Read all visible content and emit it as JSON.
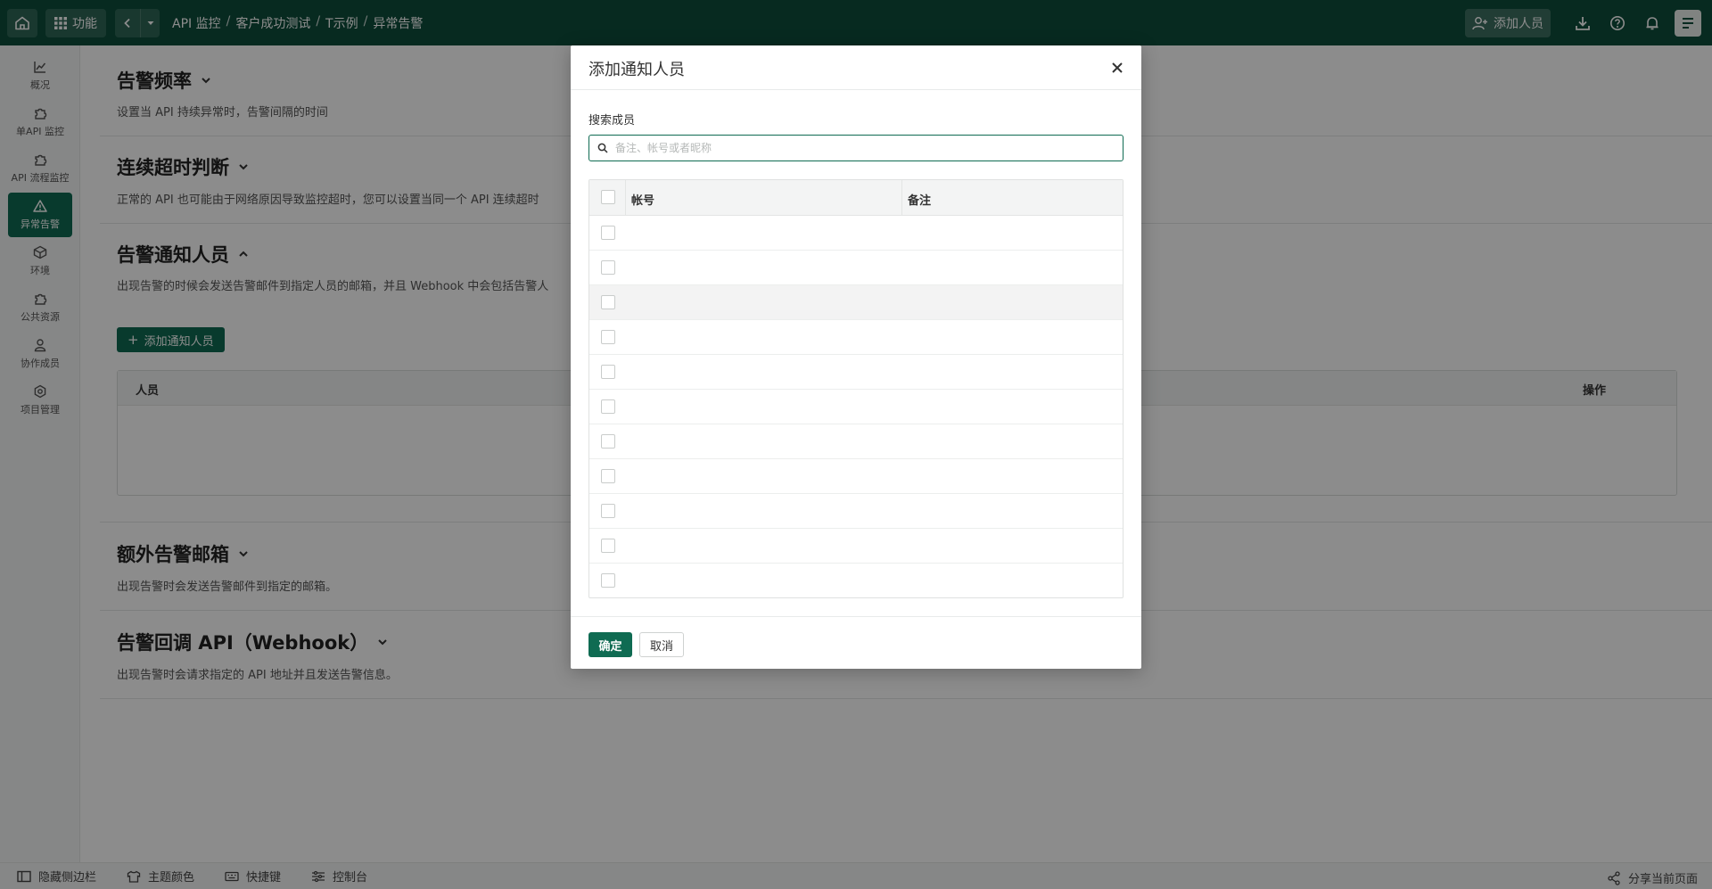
{
  "topbar": {
    "func_label": "功能",
    "breadcrumbs": [
      "API 监控",
      "客户成功测试",
      "T示例",
      "异常告警"
    ],
    "add_member_label": "添加人员"
  },
  "sidebar": {
    "items": [
      {
        "label": "概况",
        "icon": "chart-line-icon"
      },
      {
        "label": "单API 监控",
        "icon": "puzzle-icon"
      },
      {
        "label": "API 流程监控",
        "icon": "puzzle-icon"
      },
      {
        "label": "异常告警",
        "icon": "warning-icon",
        "active": true
      },
      {
        "label": "环境",
        "icon": "box-icon"
      },
      {
        "label": "公共资源",
        "icon": "puzzle-icon"
      },
      {
        "label": "协作成员",
        "icon": "user-icon"
      },
      {
        "label": "项目管理",
        "icon": "gear-icon"
      }
    ]
  },
  "main": {
    "sections": [
      {
        "title": "告警频率",
        "desc": "设置当 API 持续异常时，告警间隔的时间"
      },
      {
        "title": "连续超时判断",
        "desc": "正常的 API 也可能由于网络原因导致监控超时，您可以设置当同一个 API 连续超时"
      },
      {
        "title": "告警通知人员",
        "desc": "出现告警的时候会发送告警邮件到指定人员的邮箱，并且 Webhook 中会包括告警人"
      },
      {
        "title": "额外告警邮箱",
        "desc": "出现告警时会发送告警邮件到指定的邮箱。"
      },
      {
        "title": "告警回调 API（Webhook）",
        "desc": "出现告警时会请求指定的 API 地址并且发送告警信息。"
      }
    ],
    "add_notify_label": "添加通知人员",
    "table_headers": {
      "person": "人员",
      "action": "操作"
    }
  },
  "footer": {
    "hide_sidebar": "隐藏侧边栏",
    "theme_color": "主题颜色",
    "shortcuts": "快捷键",
    "console": "控制台",
    "share": "分享当前页面"
  },
  "modal": {
    "title": "添加通知人员",
    "search_label": "搜索成员",
    "search_placeholder": "备注、帐号或者昵称",
    "search_value": "",
    "columns": {
      "account": "帐号",
      "note": "备注"
    },
    "rows": [
      {
        "account": "",
        "note": ""
      },
      {
        "account": "",
        "note": ""
      },
      {
        "account": "",
        "note": ""
      },
      {
        "account": "",
        "note": ""
      },
      {
        "account": "",
        "note": ""
      },
      {
        "account": "",
        "note": ""
      },
      {
        "account": "",
        "note": ""
      },
      {
        "account": "",
        "note": ""
      },
      {
        "account": "",
        "note": ""
      },
      {
        "account": "",
        "note": ""
      },
      {
        "account": "",
        "note": ""
      }
    ],
    "ok_label": "确定",
    "cancel_label": "取消"
  },
  "colors": {
    "primary": "#0f6b52",
    "topbar": "#0d4d3b"
  }
}
